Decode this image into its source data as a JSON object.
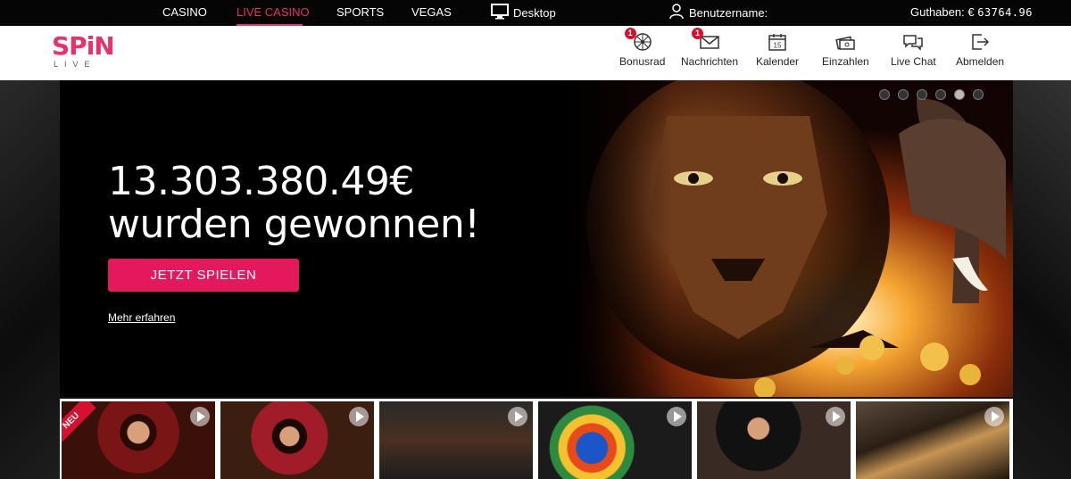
{
  "topbar": {
    "nav": [
      "CASINO",
      "LIVE CASINO",
      "SPORTS",
      "VEGAS"
    ],
    "desktop_label": "Desktop",
    "username_label": "Benutzername:",
    "balance_label": "Guthaben: €",
    "balance_amount": "63764.96"
  },
  "logo": {
    "main": "SPiN",
    "sub": "LIVE"
  },
  "header": {
    "items": [
      {
        "label": "Bonusrad",
        "icon": "wheel-icon",
        "badge": "1"
      },
      {
        "label": "Nachrichten",
        "icon": "envelope-icon",
        "badge": "1"
      },
      {
        "label": "Kalender",
        "icon": "calendar-icon",
        "badge": "",
        "calendar_day": "15"
      },
      {
        "label": "Einzahlen",
        "icon": "deposit-icon",
        "badge": ""
      },
      {
        "label": "Live Chat",
        "icon": "chat-icon",
        "badge": ""
      },
      {
        "label": "Abmelden",
        "icon": "logout-icon",
        "badge": ""
      }
    ]
  },
  "hero": {
    "line1": "13.303.380.49€",
    "line2": "wurden gewonnen!",
    "cta": "JETZT SPIELEN",
    "more": "Mehr erfahren",
    "slide_count": 6,
    "active_slide": 5
  },
  "tiles": [
    {
      "name": "tile-1",
      "badge": "NEU"
    },
    {
      "name": "tile-2",
      "badge": ""
    },
    {
      "name": "tile-3",
      "badge": ""
    },
    {
      "name": "tile-4",
      "badge": ""
    },
    {
      "name": "tile-5",
      "badge": ""
    },
    {
      "name": "tile-6",
      "badge": ""
    }
  ],
  "colors": {
    "accent": "#e3185d",
    "badge": "#d6102f",
    "topbar": "#050505"
  }
}
